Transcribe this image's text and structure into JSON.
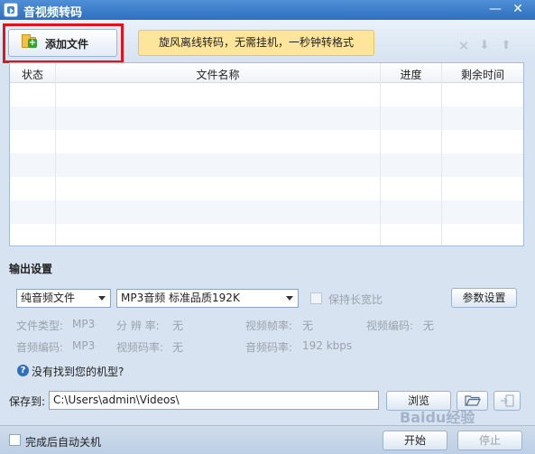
{
  "window": {
    "title": "音视频转码",
    "minimize": "—",
    "close": "✕"
  },
  "toolbar": {
    "add_file_label": "添加文件",
    "promo_text": "旋风离线转码，无需挂机，一秒钟转格式",
    "icons": [
      "close-icon",
      "arrow-down-icon",
      "arrow-up-icon"
    ]
  },
  "file_list": {
    "columns": [
      "状态",
      "文件名称",
      "进度",
      "剩余时间"
    ],
    "rows": []
  },
  "output": {
    "section_title": "输出设置",
    "category_select": "纯音频文件",
    "format_select": "MP3音频 标准品质192K",
    "keep_ratio_label": "保持长宽比",
    "params_button": "参数设置",
    "info": {
      "file_type": "文件类型:",
      "file_type_value": "MP3",
      "resolution": "分 辨 率:",
      "resolution_value": "无",
      "video_fps": "视频帧率:",
      "video_fps_value": "无",
      "video_codec": "视频编码:",
      "video_codec_value": "无",
      "audio_codec": "音频编码:",
      "audio_codec_value": "MP3",
      "video_bitrate": "视频码率:",
      "video_bitrate_value": "无",
      "audio_bitrate": "音频码率:",
      "audio_bitrate_value": "192 kbps"
    },
    "help_link": "没有找到您的机型?"
  },
  "save": {
    "label": "保存到:",
    "path": "C:\\Users\\admin\\Videos\\",
    "browse_button": "浏览"
  },
  "bottom": {
    "auto_shutdown_label": "完成后自动关机",
    "start_button": "开始",
    "stop_button": "停止"
  },
  "watermark": "Baidu经验"
}
